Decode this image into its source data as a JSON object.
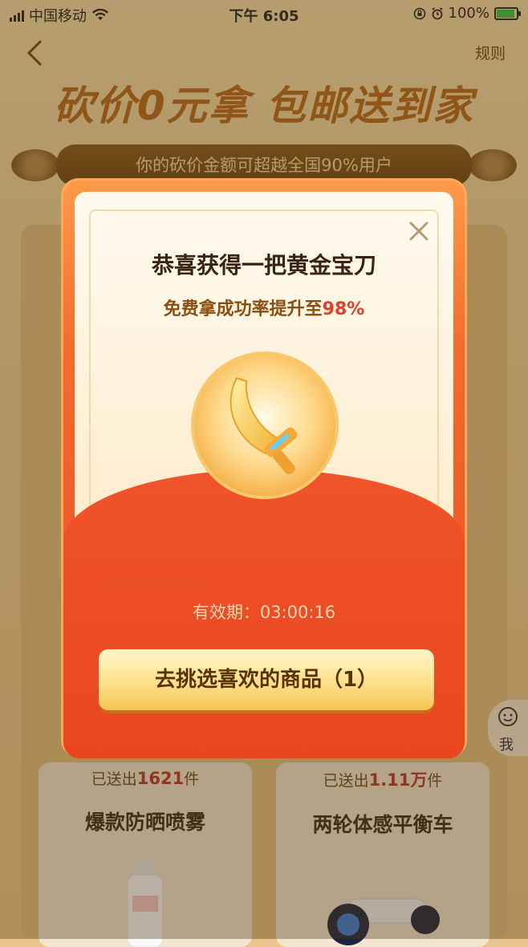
{
  "status_bar": {
    "carrier": "中国移动",
    "time": "下午 6:05",
    "battery": "100%"
  },
  "header": {
    "rules_label": "规则",
    "hero_title": "砍价0元拿 包邮送到家",
    "banner_text": "你的砍价金额可超越全国90%用户"
  },
  "products": [
    {
      "sold_prefix": "已送出",
      "sold_count": "1621",
      "sold_unit": "件",
      "name": "爆款防晒喷雾"
    },
    {
      "sold_prefix": "已送出",
      "sold_count": "1.11万",
      "sold_unit": "件",
      "name": "两轮体感平衡车"
    }
  ],
  "side_tab": {
    "label": "我"
  },
  "modal": {
    "title": "恭喜获得一把黄金宝刀",
    "subtitle_prefix": "免费拿成功率提升至",
    "subtitle_percent": "98%",
    "expiry_label": "有效期：03:00:16",
    "cta_label": "去挑选喜欢的商品（1）"
  },
  "icons": {
    "back": "chevron-left-icon",
    "close": "close-icon",
    "prize": "golden-sword-icon"
  },
  "colors": {
    "modal_accent": "#ea4b22",
    "highlight": "#e0412a",
    "cta_gold": "#ffe08a"
  }
}
